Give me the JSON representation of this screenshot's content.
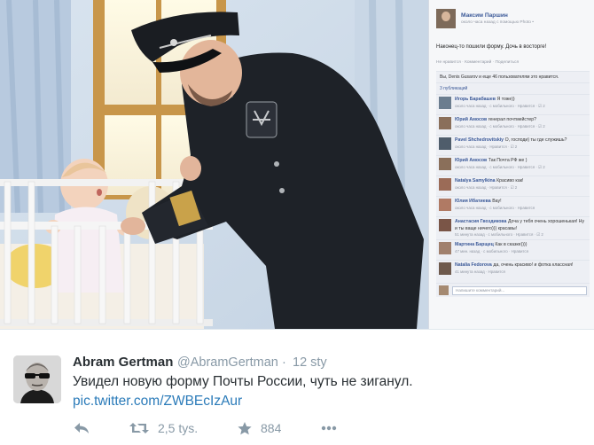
{
  "facebook": {
    "poster_name": "Максим Паршин",
    "poster_meta": "около часа назад с помощью Photo •",
    "post_text": "Наконец-то пошили форму. Дочь в восторге!",
    "actions": "Не нравится · Комментарий · Поделиться",
    "likes": "Вы, Denis Gusarov и еще 46 пользователям это нравится.",
    "shares": "3 публикаций",
    "comments": [
      {
        "name": "Игорь Барабашев",
        "text": "Я тоже))",
        "meta": "около часа назад · с мобильного · Нравится · ☑ 2",
        "avatar_color": "#6b7d8f"
      },
      {
        "name": "Юрий Амосов",
        "text": "генерал почтмейстер?",
        "meta": "около часа назад · с мобильного · Нравится · ☑ 2",
        "avatar_color": "#8a6f5a"
      },
      {
        "name": "Pavel Shchedrovitskiy",
        "text": "О, господи) ты где служишь?",
        "meta": "около часа назад · Нравится · ☑ 2",
        "avatar_color": "#4f5d6b"
      },
      {
        "name": "Юрий Амосов",
        "text": "Так Почта РФ же )",
        "meta": "около часа назад · с мобильного · Нравится · ☑ 2",
        "avatar_color": "#8a6f5a"
      },
      {
        "name": "Natalya Samylkina",
        "text": "Красиво как!",
        "meta": "около часа назад · Нравится · ☑ 2",
        "avatar_color": "#9b6b57"
      },
      {
        "name": "Юлия Ибатиева",
        "text": "Вау!",
        "meta": "около часа назад · с мобильного · Нравится",
        "avatar_color": "#b07a64"
      },
      {
        "name": "Анастасия Гвоздикова",
        "text": "Доча у тебя очень хорошенькая! Ну и ты ваще ничего))) красавы!",
        "meta": "51 минута назад · с мобильного · Нравится · ☑ 2",
        "avatar_color": "#7a5547"
      },
      {
        "name": "Мартина Барщец",
        "text": "Как в сказке))))",
        "meta": "47 мин. назад · с мобильного · Нравится",
        "avatar_color": "#a0806d"
      },
      {
        "name": "Natalia Fedorova",
        "text": "да, очень красиво! и фотка классная!",
        "meta": "41 минута назад · Нравится",
        "avatar_color": "#6e5a4d"
      }
    ],
    "write_placeholder": "Напишите комментарий..."
  },
  "tweet": {
    "name": "Abram Gertman",
    "handle": "@AbramGertman",
    "separator": "·",
    "time": "12 sty",
    "text": "Увидел новую форму Почты России, чуть не зиганул.",
    "link": "pic.twitter.com/ZWBEcIzAur",
    "retweets": "2,5 tys.",
    "favorites": "884"
  },
  "icons": {
    "reply": "reply-icon",
    "retweet": "retweet-icon",
    "favorite": "star-icon",
    "more": "more-dots-icon"
  },
  "colors": {
    "twitter_link": "#2b7bb9",
    "twitter_gray": "#8899a6",
    "facebook_blue": "#3b5998"
  }
}
